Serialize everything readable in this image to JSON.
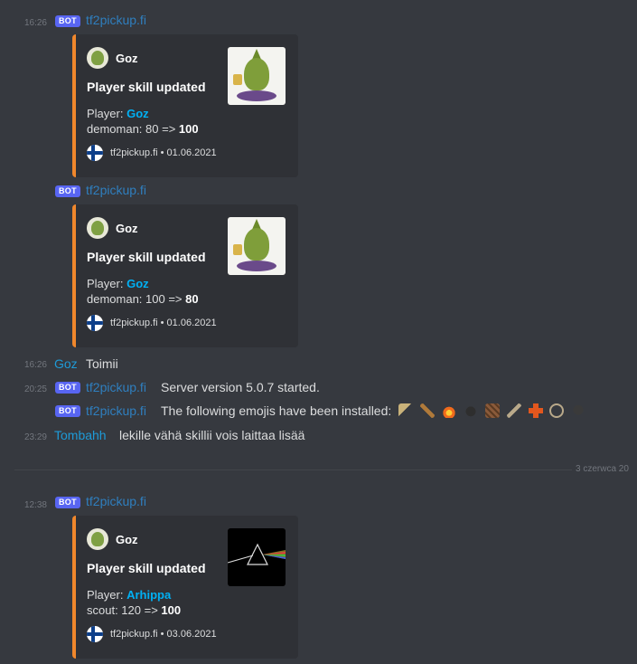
{
  "messages": {
    "m1": {
      "time": "16:26",
      "bot_tag": "BOT",
      "author": "tf2pickup.fi"
    },
    "m2": {
      "bot_tag": "BOT",
      "author": "tf2pickup.fi"
    },
    "m3": {
      "time": "16:26",
      "author": "Goz",
      "text": "Toimii"
    },
    "m4": {
      "time": "20:25",
      "bot_tag": "BOT",
      "author": "tf2pickup.fi",
      "text": "Server version 5.0.7 started."
    },
    "m5": {
      "bot_tag": "BOT",
      "author": "tf2pickup.fi",
      "text": "The following emojis have been installed:",
      "emojis": [
        "scattergun-emoji",
        "rocket-emoji",
        "flame-emoji",
        "bomb-emoji",
        "sticky-emoji",
        "wrench-emoji",
        "medic-cross-emoji",
        "crosshair-emoji",
        "spy-emoji"
      ]
    },
    "m6": {
      "time": "23:29",
      "author": "Tombahh",
      "text": "lekille vähä skillii vois laittaa lisää"
    },
    "m7": {
      "time": "12:38",
      "bot_tag": "BOT",
      "author": "tf2pickup.fi"
    }
  },
  "divider": {
    "label": "3 czerwca 20"
  },
  "embeds": [
    {
      "author": "Goz",
      "title": "Player skill updated",
      "player_label": "Player:",
      "player": "Goz",
      "stat_prefix": "demoman: 80 =>",
      "stat_value": "100",
      "footer": "tf2pickup.fi • 01.06.2021"
    },
    {
      "author": "Goz",
      "title": "Player skill updated",
      "player_label": "Player:",
      "player": "Goz",
      "stat_prefix": "demoman: 100 =>",
      "stat_value": "80",
      "footer": "tf2pickup.fi • 01.06.2021"
    },
    {
      "author": "Goz",
      "title": "Player skill updated",
      "player_label": "Player:",
      "player": "Arhippa",
      "stat_prefix": "scout: 120 =>",
      "stat_value": "100",
      "footer": "tf2pickup.fi • 03.06.2021"
    }
  ],
  "colors": {
    "bot_tag": "#5865f2",
    "embed_accent": "#f0872c",
    "link": "#00b0f4",
    "background": "#36393f"
  }
}
